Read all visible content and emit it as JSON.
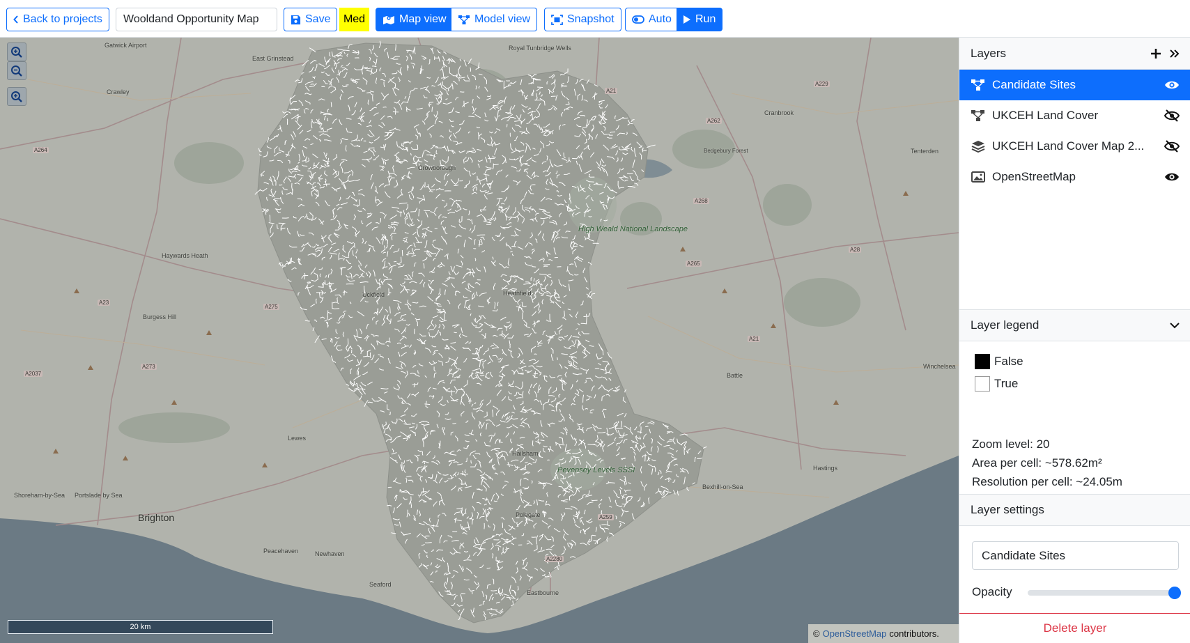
{
  "toolbar": {
    "back_label": "Back to projects",
    "project_name": "Wooldand Opportunity Map",
    "save_label": "Save",
    "quality_label": "Med",
    "map_view_label": "Map view",
    "model_view_label": "Model view",
    "snapshot_label": "Snapshot",
    "auto_label": "Auto",
    "run_label": "Run"
  },
  "map": {
    "scale_label": "20 km",
    "attribution_prefix": "©",
    "attribution_link": "OpenStreetMap",
    "attribution_suffix": "contributors.",
    "places": {
      "gatwick": "Gatwick Airport",
      "east_grinstead": "East Grinstead",
      "crawley": "Crawley",
      "royal_tunbridge_wells": "Royal Tunbridge Wells",
      "cranbrook": "Cranbrook",
      "tenterden": "Tenterden",
      "crowborough": "Crowborough",
      "bedgebury": "Bedgebury Forest",
      "haywards_heath": "Haywards Heath",
      "burgess_hill": "Burgess Hill",
      "uckfield": "Uckfield",
      "heathfield": "Heathfield",
      "battle": "Battle",
      "winchelsea": "Winchelsea",
      "lewes": "Lewes",
      "hailsham": "Hailsham",
      "pevensey": "Pevensey Levels SSSI",
      "hastings": "Hastings",
      "bexhill": "Bexhill-on-Sea",
      "shoreham": "Shoreham-by-Sea",
      "portslade": "Portslade by Sea",
      "brighton": "Brighton",
      "polegate": "Polegate",
      "peacehaven": "Peacehaven",
      "newhaven": "Newhaven",
      "seaford": "Seaford",
      "eastbourne": "Eastbourne",
      "high_weald": "High Weald National Landscape"
    },
    "roads": {
      "a229": "A229",
      "a21a": "A21",
      "a262": "A262",
      "a264": "A264",
      "a268": "A268",
      "a265": "A265",
      "a28": "A28",
      "a23": "A23",
      "a275": "A275",
      "a273": "A273",
      "a2037": "A2037",
      "a21b": "A21",
      "a259": "A259",
      "a2280": "A2280"
    }
  },
  "layers_panel": {
    "title": "Layers",
    "items": [
      {
        "label": "Candidate Sites",
        "icon": "model-icon",
        "visible": true,
        "active": true
      },
      {
        "label": "UKCEH Land Cover",
        "icon": "model-icon",
        "visible": false,
        "active": false
      },
      {
        "label": "UKCEH Land Cover Map 2...",
        "icon": "layers-icon",
        "visible": false,
        "active": false
      },
      {
        "label": "OpenStreetMap",
        "icon": "image-icon",
        "visible": true,
        "active": false
      }
    ]
  },
  "legend": {
    "title": "Layer legend",
    "items": [
      {
        "label": "False",
        "color": "#000000"
      },
      {
        "label": "True",
        "color": "#ffffff"
      }
    ],
    "zoom_level": "Zoom level: 20",
    "area_per_cell": "Area per cell: ~578.62m²",
    "resolution_per_cell": "Resolution per cell: ~24.05m"
  },
  "settings": {
    "title": "Layer settings",
    "layer_name": "Candidate Sites",
    "opacity_label": "Opacity",
    "opacity": 1.0,
    "delete_label": "Delete layer"
  },
  "colors": {
    "primary": "#0d6efd",
    "danger": "#dc3545",
    "highlight": "#ffff00"
  }
}
